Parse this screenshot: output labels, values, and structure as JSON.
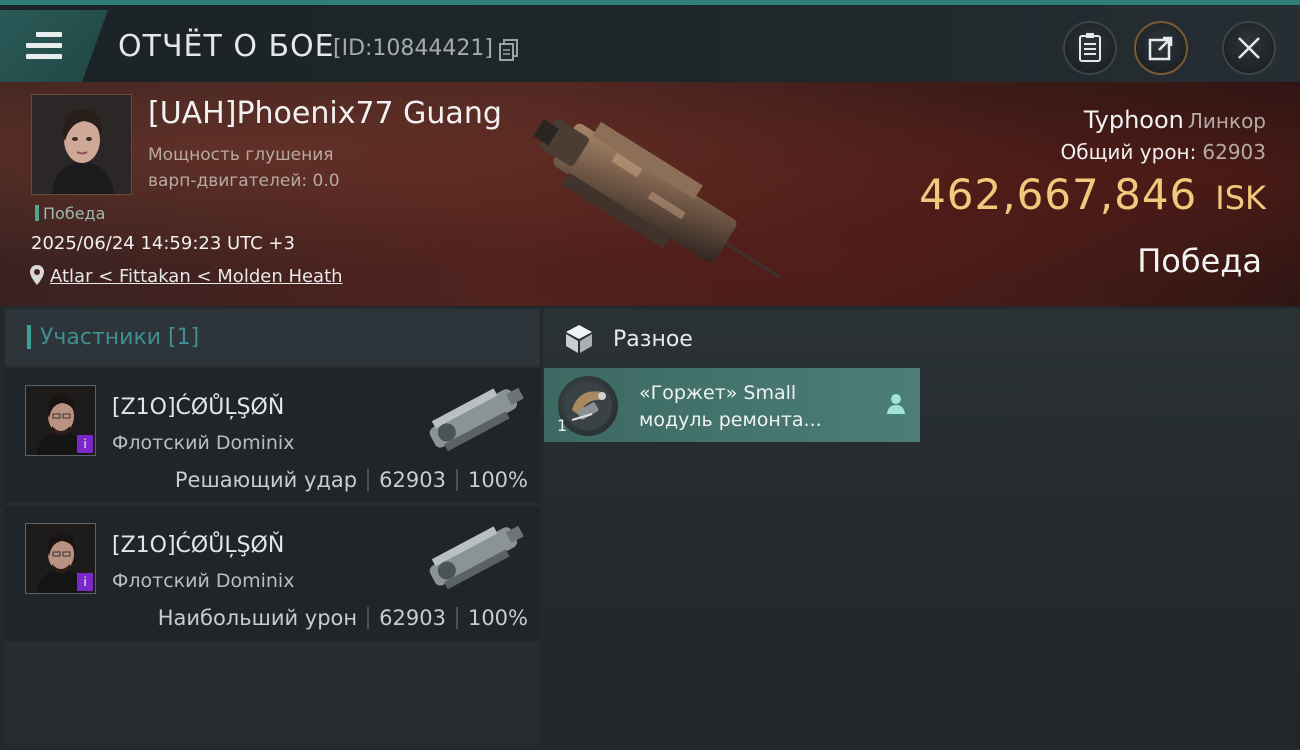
{
  "header": {
    "title": "ОТЧЁТ О БОЕ",
    "report_id": "[ID:10844421]"
  },
  "victim": {
    "pilot_name": "[UAH]Phoenix77 Guang",
    "jam_line1": "Мощность глушения",
    "jam_line2": "варп-двигателей: 0.0",
    "status": "Победа",
    "datetime": "2025/06/24 14:59:23 UTC +3",
    "location": "Atlar < Fittakan < Molden Heath",
    "ship_name": "Typhoon",
    "ship_class": "Линкор",
    "total_damage_label": "Общий урон:",
    "total_damage_value": "62903",
    "isk_value": "462,667,846",
    "isk_unit": "ISK",
    "result": "Победа"
  },
  "participants": {
    "header": "Участники [1]",
    "rows": [
      {
        "name": "[Z1O]ĆØŮĻŞØŇ",
        "ship": "Флотский Dominix",
        "role": "Решающий удар",
        "damage": "62903",
        "percent": "100%",
        "badge": "i"
      },
      {
        "name": "[Z1O]ĆØŮĻŞØŇ",
        "ship": "Флотский Dominix",
        "role": "Наибольший урон",
        "damage": "62903",
        "percent": "100%",
        "badge": "i"
      }
    ]
  },
  "drops": {
    "category": "Разное",
    "items": [
      {
        "quantity": "1",
        "name_line1": "«Горжет» Small",
        "name_line2": "модуль ремонта..."
      }
    ]
  },
  "colors": {
    "accent": "#2f7f78",
    "isk_gold": "#f2c97c",
    "item_card": "#4c7e77",
    "badge_purple": "#7a28c9"
  }
}
